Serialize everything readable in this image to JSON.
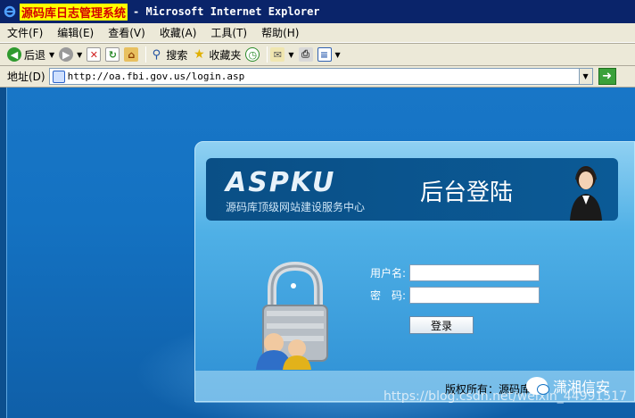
{
  "window": {
    "title_highlight": "源码库日志管理系统",
    "title_rest": "- Microsoft Internet Explorer"
  },
  "menu": {
    "items": [
      "文件(F)",
      "编辑(E)",
      "查看(V)",
      "收藏(A)",
      "工具(T)",
      "帮助(H)"
    ]
  },
  "toolbar": {
    "back_label": "后退",
    "search_label": "搜索",
    "favorites_label": "收藏夹"
  },
  "address": {
    "label": "地址(D)",
    "url": "http://oa.fbi.gov.us/login.asp"
  },
  "banner": {
    "logo": "ASPKU",
    "slogan": "源码库顶级网站建设服务中心",
    "title": "后台登陆"
  },
  "form": {
    "username_label": "用户名:",
    "password_label": "密　码:",
    "username_value": "",
    "password_value": "",
    "submit_label": "登录"
  },
  "footer": {
    "copyright": "版权所有：源码库"
  },
  "overlay": {
    "url_watermark": "https://blog.csdn.net/weixin_44991517",
    "wechat_name": "潇湘信安"
  },
  "colors": {
    "titlebar": "#0a246a",
    "page_bg": "#1472c2",
    "panel": "#4fb0e6",
    "banner": "#0b5a96"
  }
}
